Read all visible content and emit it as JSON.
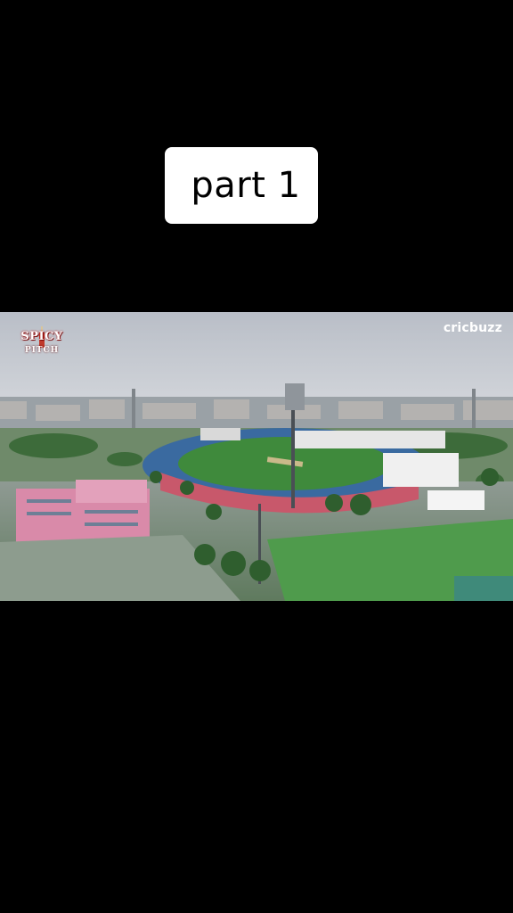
{
  "caption": {
    "text": "part 1"
  },
  "video": {
    "scene": "aerial view of cricket stadium",
    "logo_left": {
      "line1": "SPICY",
      "line2": "PITCH"
    },
    "logo_right": {
      "text": "cricbuzz"
    }
  },
  "colors": {
    "background": "#000000",
    "caption_bg": "#ffffff",
    "sky": "#c7ccd4",
    "pitch_green": "#3f8a3c",
    "building_pink": "#d98aa9"
  }
}
